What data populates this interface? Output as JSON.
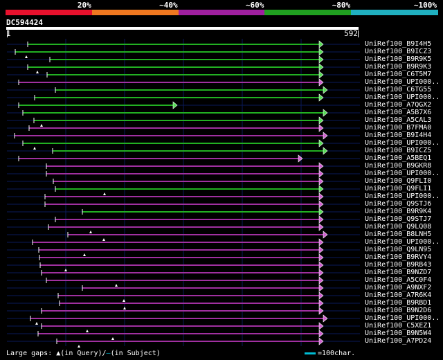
{
  "legend": {
    "segments": [
      {
        "color": "#e8112d"
      },
      {
        "color": "#f07820"
      },
      {
        "color": "#a020a0"
      },
      {
        "color": "#20a020"
      },
      {
        "color": "#20b0c0"
      }
    ],
    "labels": [
      "20%",
      "~40%",
      "~60%",
      "~80%",
      "~100%"
    ]
  },
  "query": {
    "id": "DC594424",
    "start": "1",
    "end": "592"
  },
  "hits": [
    {
      "label": "UniRef100_B9I4H5",
      "color": "green",
      "start": 40,
      "end": 467,
      "gap": null
    },
    {
      "label": "UniRef100_B9ICZ3",
      "color": "green",
      "start": 22,
      "end": 467,
      "gap": 38
    },
    {
      "label": "UniRef100_B9R9K5",
      "color": "green",
      "start": 72,
      "end": 467,
      "gap": null
    },
    {
      "label": "UniRef100_B9R9K3",
      "color": "green",
      "start": 40,
      "end": 467,
      "gap": 54
    },
    {
      "label": "UniRef100_C6T5M7",
      "color": "green",
      "start": 68,
      "end": 467,
      "gap": null
    },
    {
      "label": "UniRef100_UPI000..",
      "color": "purple",
      "start": 27,
      "end": 467,
      "gap": null
    },
    {
      "label": "UniRef100_C6TG55",
      "color": "green",
      "start": 80,
      "end": 473,
      "gap": null
    },
    {
      "label": "UniRef100_UPI000..",
      "color": "green",
      "start": 50,
      "end": 467,
      "gap": null
    },
    {
      "label": "UniRef100_A7QGX2",
      "color": "green",
      "start": 27,
      "end": 256,
      "gap": null
    },
    {
      "label": "UniRef100_A5B7X6",
      "color": "green",
      "start": 33,
      "end": 473,
      "gap": null
    },
    {
      "label": "UniRef100_A5CAL3",
      "color": "green",
      "start": 49,
      "end": 467,
      "gap": 60
    },
    {
      "label": "UniRef100_B7FMA0",
      "color": "purple",
      "start": 42,
      "end": 467,
      "gap": null
    },
    {
      "label": "UniRef100_B9I4H4",
      "color": "purple",
      "start": 21,
      "end": 473,
      "gap": null
    },
    {
      "label": "UniRef100_UPI000..",
      "color": "green",
      "start": 33,
      "end": 467,
      "gap": 50
    },
    {
      "label": "UniRef100_B9ICZ5",
      "color": "green",
      "start": 76,
      "end": 473,
      "gap": null
    },
    {
      "label": "UniRef100_A5BEQ1",
      "color": "purple",
      "start": 27,
      "end": 437,
      "gap": null
    },
    {
      "label": "UniRef100_B9GKR8",
      "color": "purple",
      "start": 67,
      "end": 467,
      "gap": null
    },
    {
      "label": "UniRef100_UPI000..",
      "color": "purple",
      "start": 67,
      "end": 467,
      "gap": null
    },
    {
      "label": "UniRef100_Q9FLI0",
      "color": "purple",
      "start": 77,
      "end": 467,
      "gap": null
    },
    {
      "label": "UniRef100_Q9FLI1",
      "color": "green",
      "start": 80,
      "end": 467,
      "gap": 151
    },
    {
      "label": "UniRef100_UPI000..",
      "color": "purple",
      "start": 65,
      "end": 467,
      "gap": null
    },
    {
      "label": "UniRef100_Q9STJ6",
      "color": "purple",
      "start": 65,
      "end": 467,
      "gap": null
    },
    {
      "label": "UniRef100_B9R9K4",
      "color": "green",
      "start": 119,
      "end": 467,
      "gap": null
    },
    {
      "label": "UniRef100_Q9STJ7",
      "color": "purple",
      "start": 80,
      "end": 467,
      "gap": null
    },
    {
      "label": "UniRef100_Q9LQ08",
      "color": "purple",
      "start": 70,
      "end": 467,
      "gap": 131
    },
    {
      "label": "UniRef100_B8LNH5",
      "color": "purple",
      "start": 98,
      "end": 473,
      "gap": 150
    },
    {
      "label": "UniRef100_UPI000..",
      "color": "purple",
      "start": 47,
      "end": 467,
      "gap": null
    },
    {
      "label": "UniRef100_Q9LN95",
      "color": "purple",
      "start": 56,
      "end": 467,
      "gap": 122
    },
    {
      "label": "UniRef100_B9RVY4",
      "color": "purple",
      "start": 57,
      "end": 467,
      "gap": null
    },
    {
      "label": "UniRef100_B9RB43",
      "color": "purple",
      "start": 58,
      "end": 467,
      "gap": 95
    },
    {
      "label": "UniRef100_B9NZD7",
      "color": "purple",
      "start": 60,
      "end": 467,
      "gap": null
    },
    {
      "label": "UniRef100_A5C0F4",
      "color": "purple",
      "start": 67,
      "end": 467,
      "gap": 168
    },
    {
      "label": "UniRef100_A9NXF2",
      "color": "purple",
      "start": 119,
      "end": 467,
      "gap": null
    },
    {
      "label": "UniRef100_A7R6K4",
      "color": "purple",
      "start": 84,
      "end": 467,
      "gap": 179
    },
    {
      "label": "UniRef100_B9RBD1",
      "color": "purple",
      "start": 86,
      "end": 467,
      "gap": 180
    },
    {
      "label": "UniRef100_B9N2D6",
      "color": "purple",
      "start": 60,
      "end": 467,
      "gap": null
    },
    {
      "label": "UniRef100_UPI000..",
      "color": "purple",
      "start": 44,
      "end": 473,
      "gap": 53
    },
    {
      "label": "UniRef100_C5XEZ1",
      "color": "purple",
      "start": 60,
      "end": 467,
      "gap": 126
    },
    {
      "label": "UniRef100_B9N5W4",
      "color": "purple",
      "start": 55,
      "end": 467,
      "gap": 163
    },
    {
      "label": "UniRef100_A7PD24",
      "color": "purple",
      "start": 82,
      "end": 467,
      "gap": 114
    }
  ],
  "footer": {
    "gaps_text": "Large gaps:",
    "query_marker": "▲",
    "in_query": "(in Query)/",
    "subject_marker": "–",
    "in_subject": "(in Subject)",
    "scale_text": "=100char."
  },
  "colors": {
    "green": "#22b022",
    "purple": "#a030a0",
    "arrow_green": "#55dd55",
    "arrow_purple": "#d060d0",
    "grid": "#0a1a5a"
  }
}
